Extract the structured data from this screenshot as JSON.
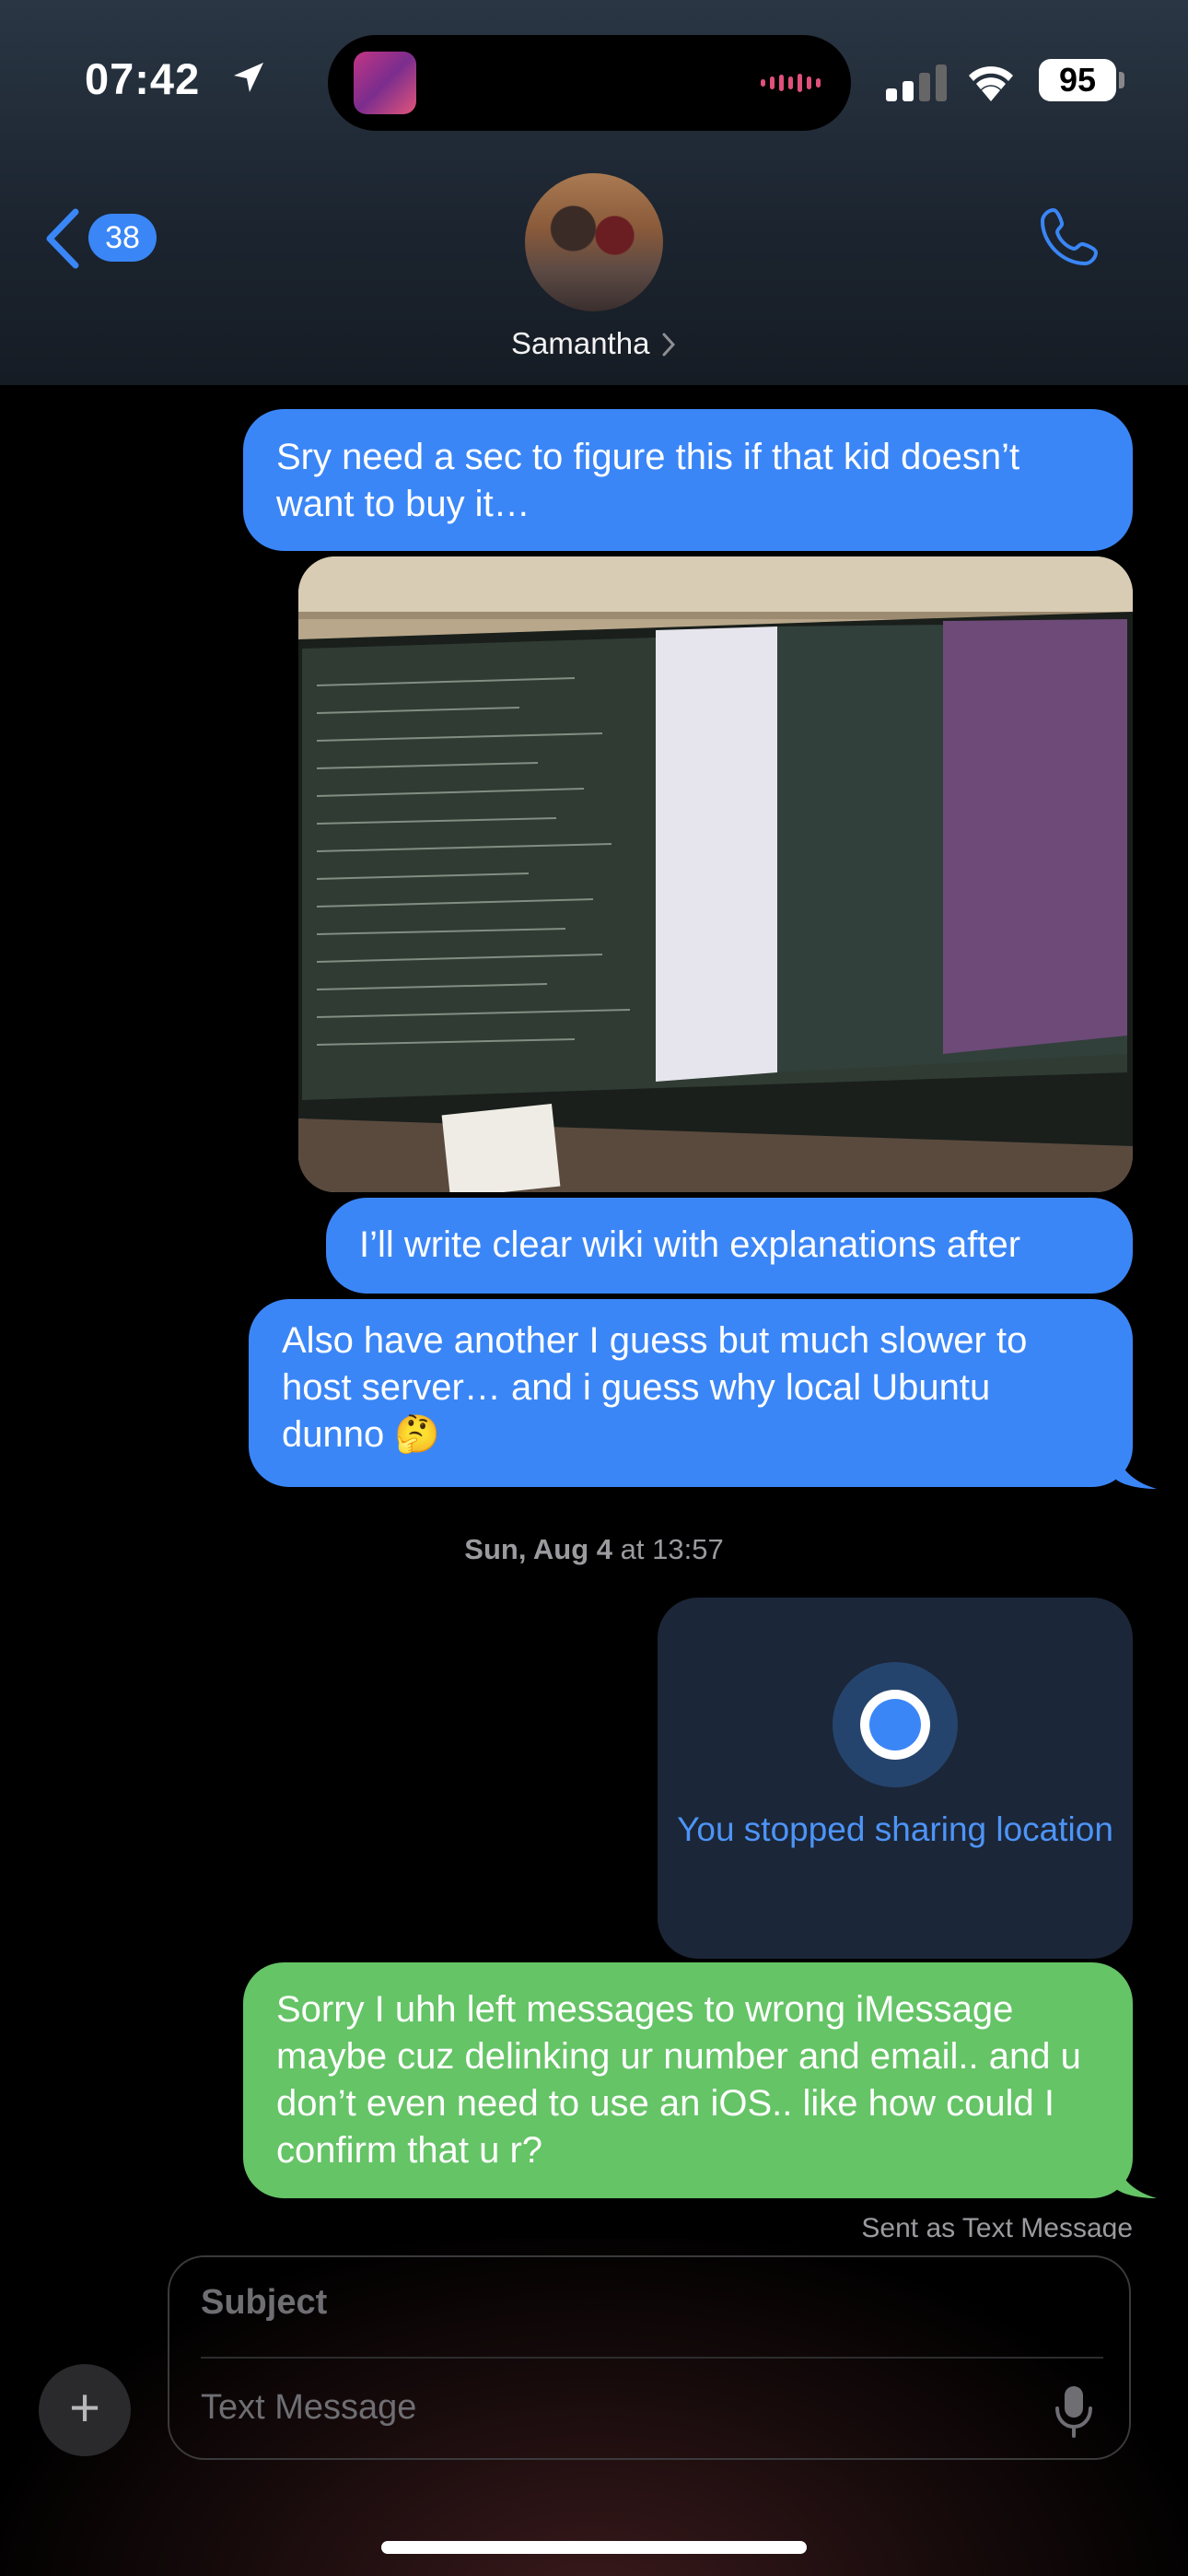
{
  "status_bar": {
    "time": "07:42",
    "battery": "95"
  },
  "nav": {
    "unread_count": "38",
    "contact_name": "Samantha"
  },
  "messages": {
    "m1": "Sry need a sec to figure this if that kid doesn’t want to buy it…",
    "m2": "I’ll write clear wiki with explanations after",
    "m3": "Also have another I guess but much slower to host server… and i guess why local Ubuntu dunno 🤔",
    "timestamp_day": "Sun, Aug 4",
    "timestamp_time": "at 13:57",
    "location_status": "You stopped sharing location",
    "m4": "Sorry I uhh left messages to wrong iMessage maybe cuz delinking ur number and email.. and u don’t even need to use an iOS.. like how could I confirm that u r?",
    "m4_note": "Sent as Text Message"
  },
  "compose": {
    "subject_placeholder": "Subject",
    "text_placeholder": "Text Message"
  },
  "colors": {
    "imessage_blue": "#3b86f7",
    "sms_green": "#65c466",
    "header_bg": "#1c2530",
    "location_card": "#1b2638"
  }
}
